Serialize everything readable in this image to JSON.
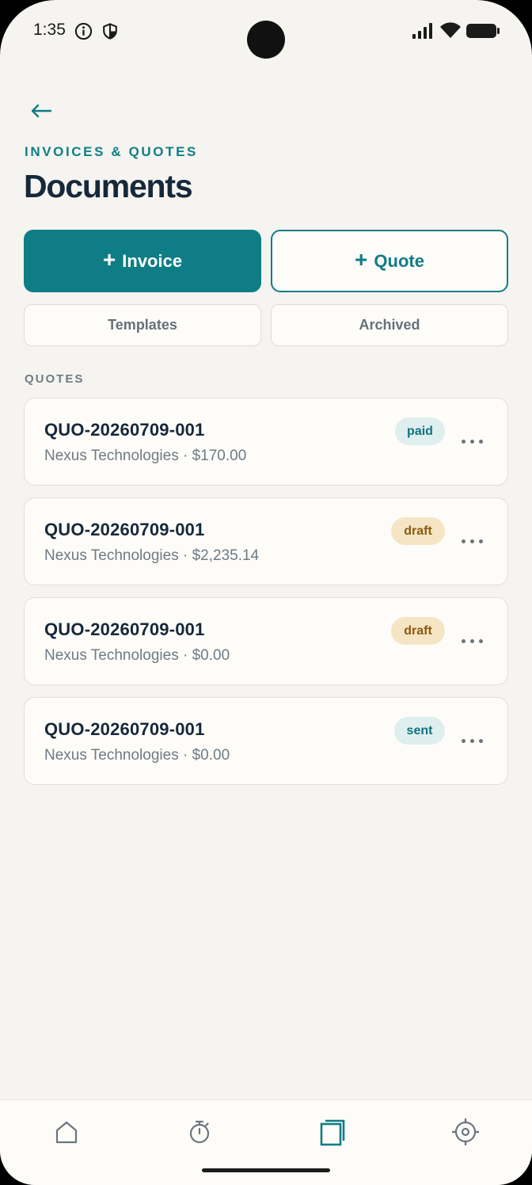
{
  "status_bar": {
    "time": "1:35"
  },
  "header": {
    "eyebrow": "INVOICES & QUOTES",
    "title": "Documents"
  },
  "actions": {
    "plus_symbol": "+",
    "invoice_label": "Invoice",
    "quote_label": "Quote",
    "templates_label": "Templates",
    "archived_label": "Archived"
  },
  "quotes": {
    "section_label": "QUOTES",
    "items": [
      {
        "id": "QUO-20260709-001",
        "subtitle": "Nexus Technologies · $170.00",
        "status": "paid"
      },
      {
        "id": "QUO-20260709-001",
        "subtitle": "Nexus Technologies · $2,235.14",
        "status": "draft"
      },
      {
        "id": "QUO-20260709-001",
        "subtitle": "Nexus Technologies · $0.00",
        "status": "draft"
      },
      {
        "id": "QUO-20260709-001",
        "subtitle": "Nexus Technologies · $0.00",
        "status": "sent"
      }
    ]
  },
  "nav": {
    "items": [
      {
        "icon": "home-icon",
        "active": false
      },
      {
        "icon": "timer-icon",
        "active": false
      },
      {
        "icon": "documents-icon",
        "active": true
      },
      {
        "icon": "settings-icon",
        "active": false
      }
    ]
  },
  "colors": {
    "accent": "#0f7d85",
    "background": "#f5f4f0",
    "card": "#fdfcf8",
    "text_dark": "#16283a",
    "text_muted": "#6f7a85",
    "badge_teal_bg": "#dfeeee",
    "badge_draft_bg": "#f5e5c4"
  }
}
